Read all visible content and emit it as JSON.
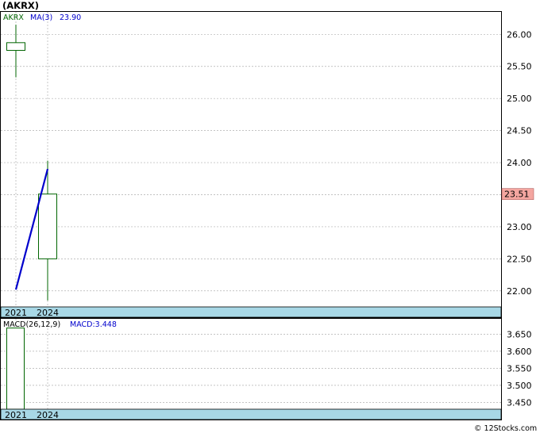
{
  "title": "(AKRX)",
  "credit": "© 12Stocks.com",
  "colors": {
    "candle": "#006400",
    "ma": "#0000cc",
    "price_tag_bg": "#f4a6a0",
    "date_band": "#a8d8e6",
    "grid": "#b0b0b0",
    "macd_bar": "#006400"
  },
  "chart_data": [
    {
      "type": "candlestick",
      "panel": "price",
      "ticker": "AKRX",
      "categories": [
        "2021",
        "2024"
      ],
      "candles": [
        {
          "x": "2021",
          "open": 25.75,
          "close": 25.87,
          "high": 26.15,
          "low": 25.33
        },
        {
          "x": "2024",
          "open": 22.5,
          "close": 23.51,
          "high": 24.03,
          "low": 21.85
        }
      ],
      "series": [
        {
          "name": "MA(3)",
          "values": [
            22.02,
            23.9
          ]
        }
      ],
      "legend": {
        "ticker": "AKRX",
        "ma_label": "MA(3)",
        "ma_value": "23.90"
      },
      "last_price_label": "23.51",
      "last_price": 23.51,
      "ylim": [
        21.75,
        26.35
      ],
      "yticks": [
        22.0,
        22.5,
        23.0,
        23.5,
        24.0,
        24.5,
        25.0,
        25.5,
        26.0
      ],
      "ytick_labels": [
        "22.00",
        "22.50",
        "23.00",
        "23.50",
        "24.00",
        "24.50",
        "25.00",
        "25.50",
        "26.00"
      ],
      "x_tick_labels": [
        "2021",
        "2024"
      ],
      "grid": true
    },
    {
      "type": "bar",
      "panel": "macd",
      "legend": {
        "label": "MACD(26,12,9)",
        "value_label": "MACD:3.448"
      },
      "categories": [
        "2021",
        "2024"
      ],
      "values": [
        3.668,
        null
      ],
      "ylim": [
        3.43,
        3.695
      ],
      "yticks": [
        3.45,
        3.5,
        3.55,
        3.6,
        3.65
      ],
      "ytick_labels": [
        "3.450",
        "3.500",
        "3.550",
        "3.600",
        "3.650"
      ],
      "x_tick_labels": [
        "2021",
        "2024"
      ],
      "grid": true
    }
  ]
}
